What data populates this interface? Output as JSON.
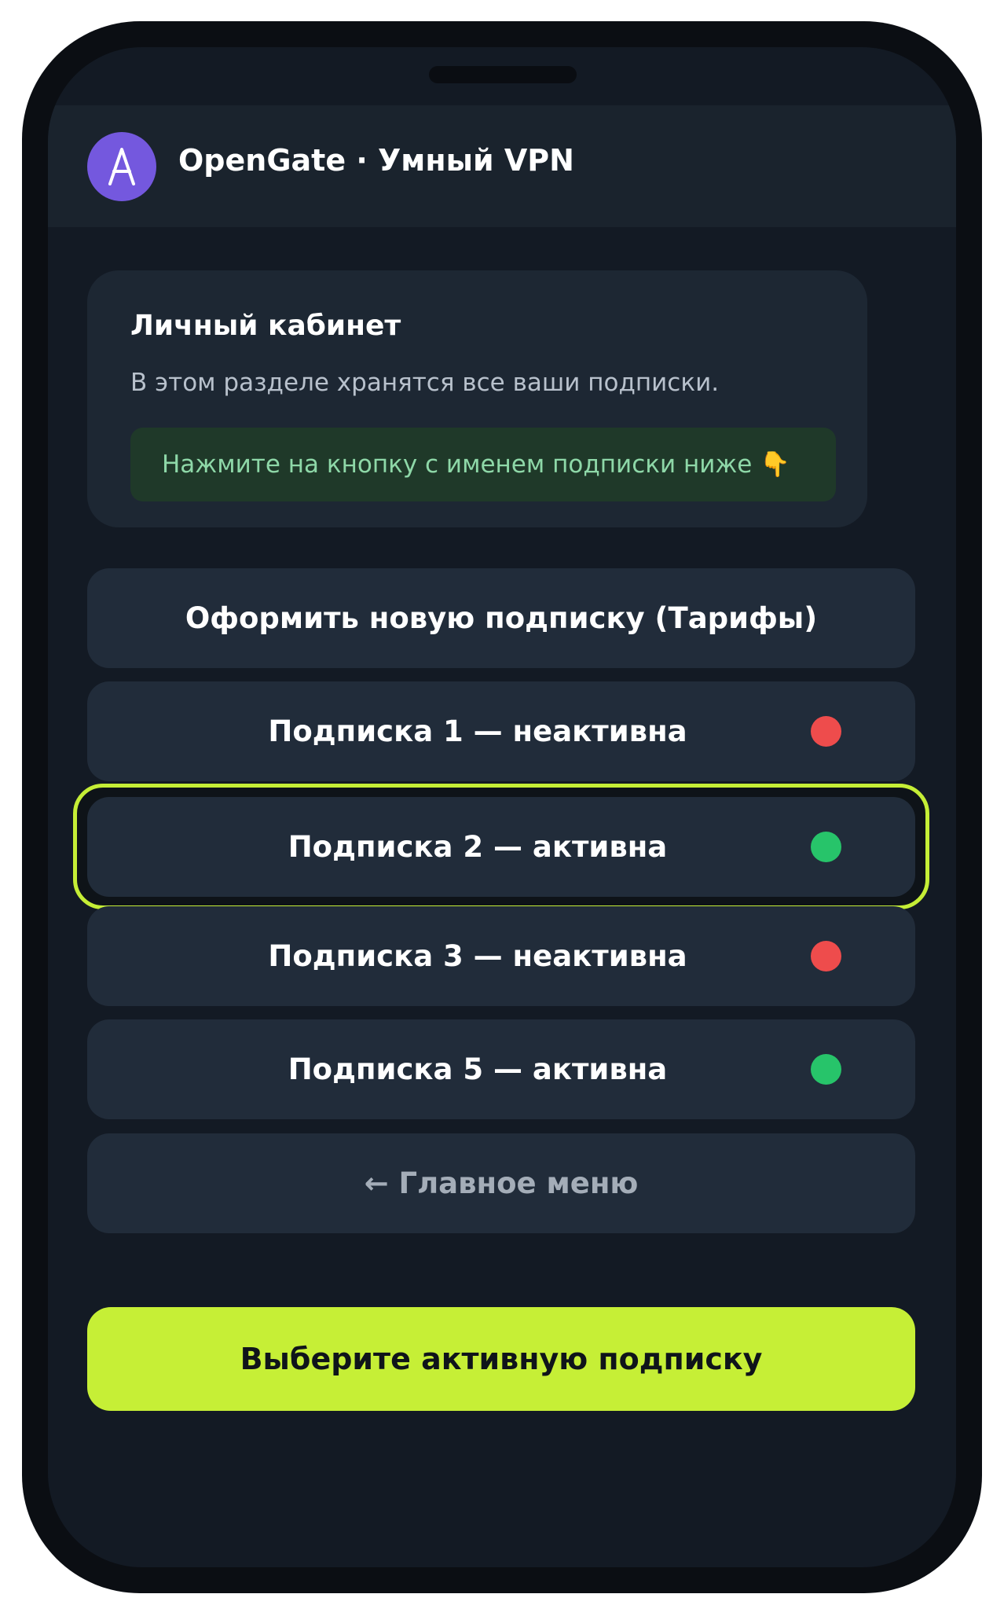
{
  "header": {
    "avatar_letter": "A",
    "title": "OpenGate · Умный VPN",
    "avatar_color": "#7458de"
  },
  "info_card": {
    "title": "Личный кабинет",
    "description": "В этом разделе хранятся все ваши подписки.",
    "hint": "Нажмите на кнопку с именем подписки ниже 👇"
  },
  "buttons": {
    "new_subscription": "Оформить новую подписку (Тарифы)",
    "subscriptions": [
      {
        "label": "Подписка 1 — неактивна",
        "status": "inactive",
        "status_color": "#ee4c4c",
        "selected": false
      },
      {
        "label": "Подписка 2 — активна",
        "status": "active",
        "status_color": "#27c46a",
        "selected": true
      },
      {
        "label": "Подписка 3 — неактивна",
        "status": "inactive",
        "status_color": "#ee4c4c",
        "selected": false
      },
      {
        "label": "Подписка 5 — активна",
        "status": "active",
        "status_color": "#27c46a",
        "selected": false
      }
    ],
    "main_menu": "← Главное меню",
    "primary_action": "Выберите активную подписку"
  },
  "colors": {
    "accent": "#c6ef36",
    "background": "#131a24",
    "card": "#1d2733",
    "button": "#212c3a"
  }
}
